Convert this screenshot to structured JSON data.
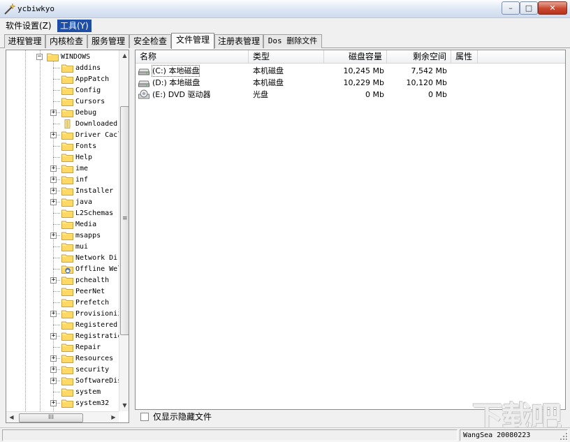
{
  "window": {
    "title": "ycbiwkyo",
    "controls": {
      "minimize": "–",
      "maximize": "□",
      "close": "✕"
    }
  },
  "menu": {
    "items": [
      {
        "label": "软件设置(Z)",
        "active": false
      },
      {
        "label": "工具(Y)",
        "active": true
      }
    ]
  },
  "tabs": [
    {
      "label": "进程管理",
      "active": false
    },
    {
      "label": "内核检查",
      "active": false
    },
    {
      "label": "服务管理",
      "active": false
    },
    {
      "label": "安全检查",
      "active": false
    },
    {
      "label": "文件管理",
      "active": true
    },
    {
      "label": "注册表管理",
      "active": false
    },
    {
      "label": "Dos 删除文件",
      "active": false
    }
  ],
  "tree": {
    "root": {
      "label": "WINDOWS",
      "expander": "−"
    },
    "items": [
      {
        "label": "addins",
        "expander": "",
        "icon": "folder"
      },
      {
        "label": "AppPatch",
        "expander": "",
        "icon": "folder"
      },
      {
        "label": "Config",
        "expander": "",
        "icon": "folder"
      },
      {
        "label": "Cursors",
        "expander": "",
        "icon": "folder"
      },
      {
        "label": "Debug",
        "expander": "+",
        "icon": "folder"
      },
      {
        "label": "Downloaded",
        "expander": "",
        "icon": "folder-special"
      },
      {
        "label": "Driver Cacl",
        "expander": "+",
        "icon": "folder"
      },
      {
        "label": "Fonts",
        "expander": "",
        "icon": "folder"
      },
      {
        "label": "Help",
        "expander": "",
        "icon": "folder"
      },
      {
        "label": "ime",
        "expander": "+",
        "icon": "folder"
      },
      {
        "label": "inf",
        "expander": "+",
        "icon": "folder"
      },
      {
        "label": "Installer",
        "expander": "+",
        "icon": "folder"
      },
      {
        "label": "java",
        "expander": "+",
        "icon": "folder"
      },
      {
        "label": "L2Schemas",
        "expander": "",
        "icon": "folder"
      },
      {
        "label": "Media",
        "expander": "",
        "icon": "folder"
      },
      {
        "label": "msapps",
        "expander": "+",
        "icon": "folder"
      },
      {
        "label": "mui",
        "expander": "",
        "icon": "folder"
      },
      {
        "label": "Network Di:",
        "expander": "",
        "icon": "folder"
      },
      {
        "label": "Offline Wel",
        "expander": "",
        "icon": "folder-sync"
      },
      {
        "label": "pchealth",
        "expander": "+",
        "icon": "folder"
      },
      {
        "label": "PeerNet",
        "expander": "",
        "icon": "folder"
      },
      {
        "label": "Prefetch",
        "expander": "",
        "icon": "folder"
      },
      {
        "label": "Provisionii",
        "expander": "+",
        "icon": "folder"
      },
      {
        "label": "Registered]",
        "expander": "",
        "icon": "folder"
      },
      {
        "label": "Registratic",
        "expander": "+",
        "icon": "folder"
      },
      {
        "label": "Repair",
        "expander": "",
        "icon": "folder"
      },
      {
        "label": "Resources",
        "expander": "+",
        "icon": "folder"
      },
      {
        "label": "security",
        "expander": "+",
        "icon": "folder"
      },
      {
        "label": "SoftwareDis",
        "expander": "+",
        "icon": "folder"
      },
      {
        "label": "system",
        "expander": "",
        "icon": "folder"
      },
      {
        "label": "system32",
        "expander": "+",
        "icon": "folder"
      }
    ],
    "scroll": {
      "up": "▲",
      "down": "▼",
      "left": "◀",
      "right": "▶",
      "vgrip": "≡",
      "hgrip": "III"
    }
  },
  "files": {
    "columns": [
      "名称",
      "类型",
      "磁盘容量",
      "剩余空间",
      "属性"
    ],
    "rows": [
      {
        "name": "(C:) 本地磁盘",
        "type": "本机磁盘",
        "capacity": "10,245 Mb",
        "free": "7,542 Mb",
        "attr": "",
        "icon": "hard-drive"
      },
      {
        "name": "(D:) 本地磁盘",
        "type": "本机磁盘",
        "capacity": "10,229 Mb",
        "free": "10,120 Mb",
        "attr": "",
        "icon": "hard-drive"
      },
      {
        "name": "(E:) DVD 驱动器",
        "type": "光盘",
        "capacity": "0 Mb",
        "free": "0 Mb",
        "attr": "",
        "icon": "dvd-drive"
      }
    ]
  },
  "show_hidden": {
    "label": "仅显示隐藏文件",
    "checked": false
  },
  "status": {
    "left": "",
    "right": "WangSea 20080223"
  },
  "watermark": "下载吧"
}
